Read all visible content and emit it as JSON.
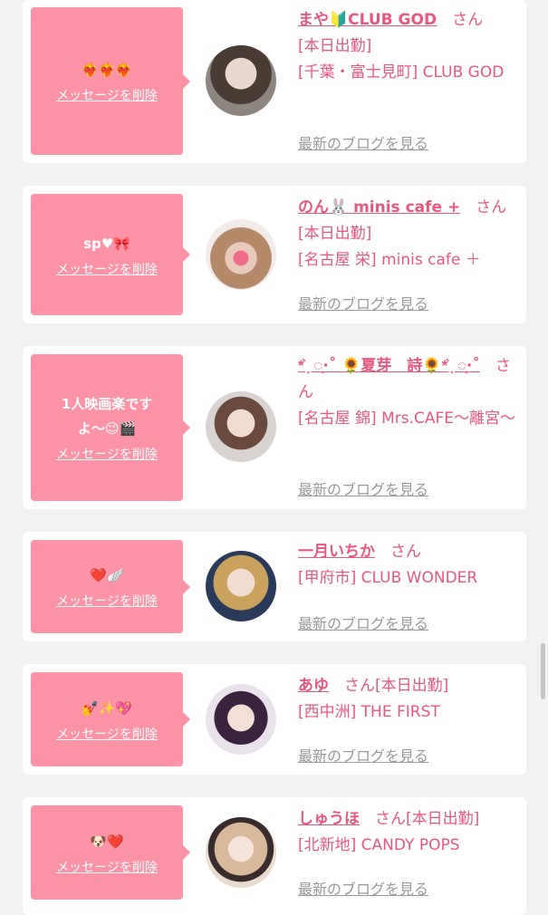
{
  "delete_label": "メッセージを削除",
  "blog_label": "最新のブログを見る",
  "san": "さん",
  "cards": [
    {
      "message": "❤️‍🔥❤️‍🔥❤️‍🔥",
      "name": "まや🔰CLUB GOD",
      "lines": [
        "[本日出勤]",
        "[千葉・富士見町] CLUB GOD"
      ]
    },
    {
      "message": "sp♥🎀",
      "name": "のん🐰 minis cafe +",
      "lines": [
        "[本日出勤]",
        "[名古屋 栄] minis cafe ＋"
      ]
    },
    {
      "message": "1人映画楽です\nよ〜😉🎬",
      "name": "*͛ ͙ ◌͙·˚ 🌻夏芽　詩🌻*͛ ͙ ◌͙·˚",
      "lines": [
        "[名古屋 錦] Mrs.CAFE〜離宮〜"
      ]
    },
    {
      "message": "❤️🪽",
      "name": "一月いちか",
      "lines": [
        "[甲府市] CLUB WONDER"
      ]
    },
    {
      "message": "💅✨💖",
      "name": "あゆ",
      "lines": [
        "[本日出勤]",
        "[西中洲] THE FIRST"
      ]
    },
    {
      "message": "🐶❤️",
      "name": "しゅうほ",
      "lines": [
        "[本日出勤]",
        "[北新地] CANDY POPS"
      ]
    }
  ]
}
